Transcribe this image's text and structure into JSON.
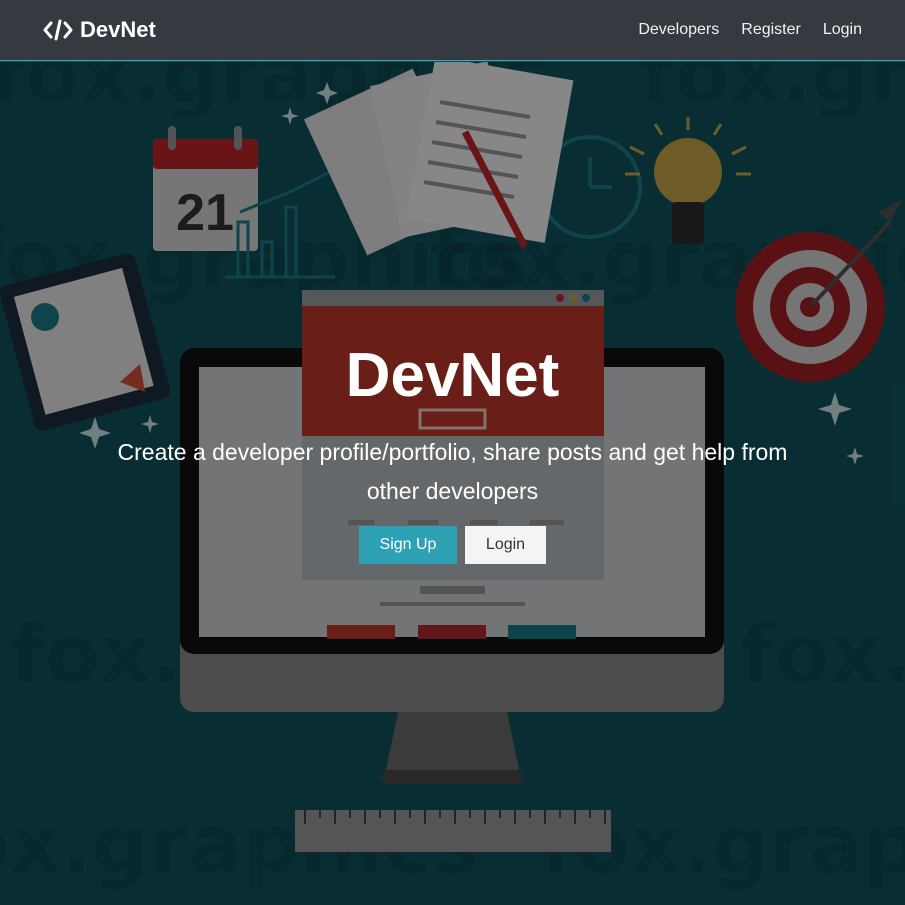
{
  "navbar": {
    "brand": "DevNet",
    "brand_icon": "code-icon",
    "links": [
      "Developers",
      "Register",
      "Login"
    ]
  },
  "hero": {
    "title": "DevNet",
    "lead": "Create a developer profile/portfolio, share posts and get help from other developers",
    "buttons": {
      "signup": "Sign Up",
      "login": "Login"
    },
    "calendar_day": "21",
    "watermark": "fox.graphics"
  },
  "colors": {
    "navbar": "#343a40",
    "primary": "#2fa1b5",
    "hero_bg": "#0f5560",
    "light_button": "#f4f4f4"
  }
}
